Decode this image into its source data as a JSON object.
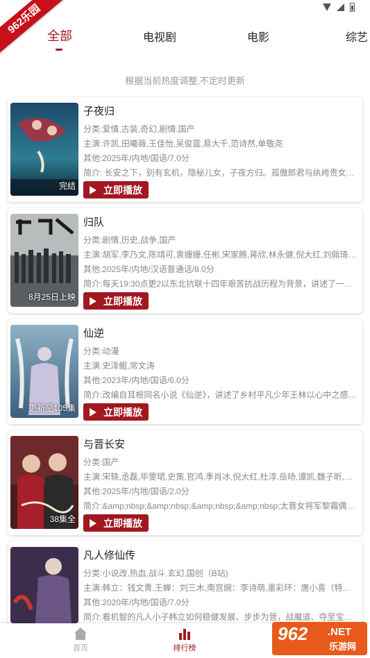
{
  "ribbon": {
    "text": "962乐园"
  },
  "tabs": [
    {
      "label": "全部",
      "active": true
    },
    {
      "label": "电视剧",
      "active": false
    },
    {
      "label": "电影",
      "active": false
    },
    {
      "label": "综艺",
      "active": false
    }
  ],
  "subtitle": "根据当前热度调整,不定时更新",
  "play_label": "立即播放",
  "items": [
    {
      "title": "子夜归",
      "category": "分类:爱情,古装,奇幻,剧情,国产",
      "cast": "主演:许凯,田曦薇,王佳怡,吴俊霆,易大千,范诗然,单敬尧",
      "other": "其他:2025年/内地/国语/7.0分",
      "intro": "简介:      长安之下，别有玄机，隐秘儿女，子夜方归。孤傲郎君与纨绔贵女…",
      "caption": "完结"
    },
    {
      "title": "归队",
      "category": "分类:剧情,历史,战争,国产",
      "cast": "主演:胡军,李乃文,陈靖可,袁姗姗,任彬,宋家腾,蒋欣,林永健,倪大红,刘佩琦,艾丽…",
      "other": "其他:2025年/内地/汉语普通话/8.0分",
      "intro": "简介:每天19:30点更2以东北抗联十四年艰苦抗战历程为背景，讲述了一支抗…",
      "caption": "8月25日上映"
    },
    {
      "title": "仙逆",
      "category": "分类:动漫",
      "cast": "主演:史泽鲲,常文涛",
      "other": "其他:2023年/内地/国语/6.0分",
      "intro": "简介:改编自耳根同名小说《仙逆》，讲述了乡村平凡少年王林以心中之感动…",
      "caption": "更新至105集"
    },
    {
      "title": "与晋长安",
      "category": "分类:国产",
      "cast": "主演:宋轶,丞磊,毕雯珺,史策,官鸿,季肖冰,倪大红,杜淳,岳旸,谭凯,魏子昕,赵圆…",
      "other": "其他:2025年/内地/国语/2.0分",
      "intro": "简介:&amp;nbsp;&amp;nbsp;&amp;nbsp;&amp;nbsp;太晋女将军黎霜偶然间…",
      "caption": "38集全"
    },
    {
      "title": "凡人修仙传",
      "category": "分类:小说改,热血,战斗,玄幻,国创（B站)",
      "cast": "主演:韩立：钱文青,王蝉：刘三木,南宫婉：李诗萌,墨彩环：唐小喜（特别篇…",
      "other": "其他:2020年/内地/国语/7.0分",
      "intro": "简介:看机智的凡人小子韩立如何稳健发展、步步为营，战魔道、夺至宝、驰…",
      "caption": ""
    }
  ],
  "nav": {
    "home": "首页",
    "rank": "排行榜"
  },
  "watermark": {
    "big": "962",
    "net": ".NET",
    "cn": "乐游网"
  },
  "colors": {
    "accent": "#a11820",
    "ribbon": "#c8101a",
    "watermark": "#e85a1b"
  }
}
